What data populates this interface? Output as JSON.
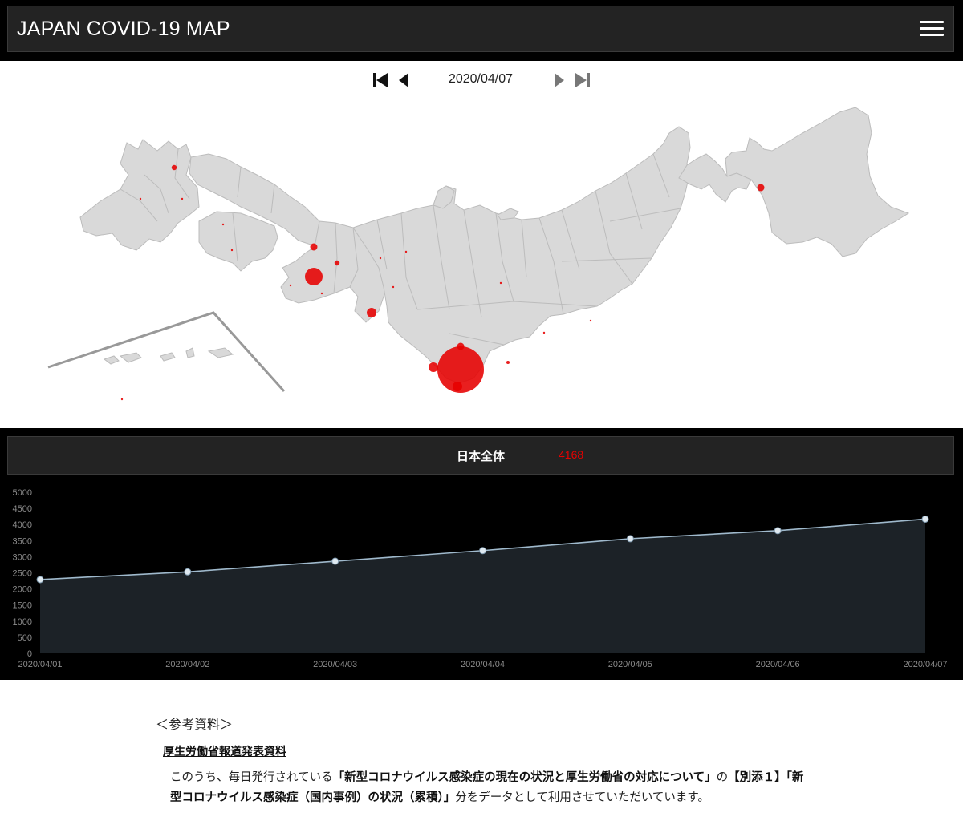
{
  "header": {
    "title": "JAPAN COVID-19 MAP",
    "menu_icon": "hamburger-menu-icon"
  },
  "navigation": {
    "current_date": "2020/04/07",
    "first_icon": "skip-first-icon",
    "prev_icon": "step-back-icon",
    "next_icon": "step-forward-icon",
    "last_icon": "skip-last-icon"
  },
  "map": {
    "land_color": "#d9d9d9",
    "border_color": "#bcbcbc",
    "marker_color": "#e60000",
    "markers": [
      {
        "region": "tokyo",
        "size": "largest"
      },
      {
        "region": "osaka",
        "size": "large"
      },
      {
        "region": "kanagawa",
        "size": "medium"
      },
      {
        "region": "chiba",
        "size": "medium"
      },
      {
        "region": "saitama",
        "size": "medium"
      },
      {
        "region": "aichi",
        "size": "medium"
      },
      {
        "region": "hokkaido",
        "size": "medium"
      },
      {
        "region": "fukuoka",
        "size": "small"
      },
      {
        "region": "hyogo",
        "size": "small"
      },
      {
        "region": "kyoto",
        "size": "small"
      }
    ]
  },
  "summary": {
    "label": "日本全体",
    "value": "4168",
    "value_color": "#e60000"
  },
  "chart_data": {
    "type": "area",
    "x": [
      "2020/04/01",
      "2020/04/02",
      "2020/04/03",
      "2020/04/04",
      "2020/04/05",
      "2020/04/06",
      "2020/04/07"
    ],
    "values": [
      2290,
      2530,
      2860,
      3190,
      3560,
      3810,
      4168
    ],
    "ylim": [
      0,
      5000
    ],
    "yticks": [
      "0",
      "500",
      "1000",
      "1500",
      "2000",
      "2500",
      "3000",
      "3500",
      "4000",
      "4500",
      "5000"
    ],
    "grid": false,
    "line_color": "#9fb9cc",
    "fill_color": "#1c2227"
  },
  "references": {
    "heading": "＜参考資料＞",
    "link_text": "厚生労働省報道発表資料",
    "body_prefix": "このうち、毎日発行されている",
    "body_bold1": "「新型コロナウイルス感染症の現在の状況と厚生労働省の対応について」",
    "body_mid": "の",
    "body_bold2": "【別添１】「新型コロナウイルス感染症（国内事例）の状況（累積）」",
    "body_suffix": "分をデータとして利用させていただいています。"
  }
}
